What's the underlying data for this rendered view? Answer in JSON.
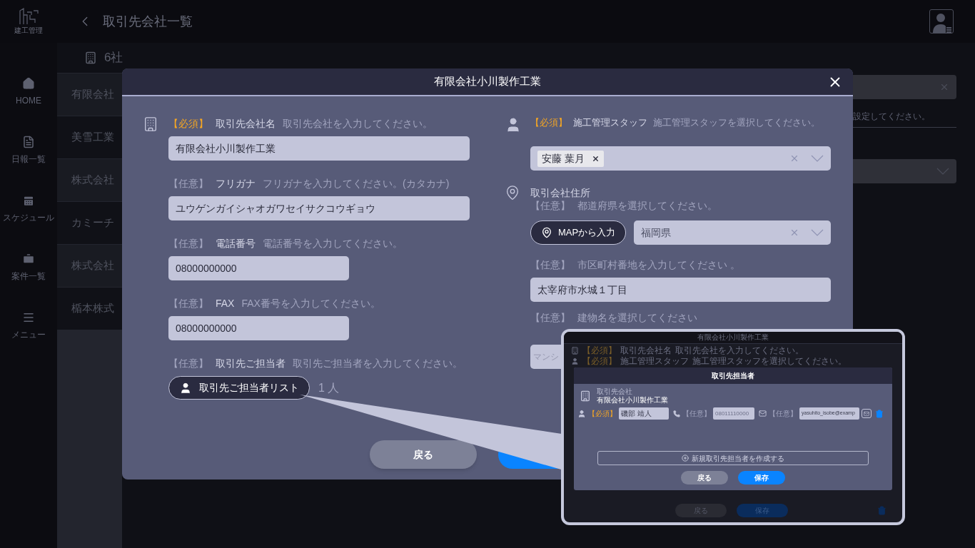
{
  "header": {
    "logo_text": "建工管理",
    "title": "取引先会社一覧"
  },
  "sidebar": {
    "items": [
      {
        "label": "HOME"
      },
      {
        "label": "日報一覧"
      },
      {
        "label": "スケジュール"
      },
      {
        "label": "案件一覧"
      },
      {
        "label": "メニュー"
      }
    ]
  },
  "list": {
    "count": "6社",
    "rows": [
      "有限会社",
      "美雪工業",
      "株式会社",
      "カミーチ",
      "株式会社",
      "楯本株式"
    ]
  },
  "side_panel": {
    "hint": "設定してください。"
  },
  "modal": {
    "title": "有限会社小川製作工業",
    "left_fields": [
      {
        "kind": "wide",
        "badge": "【必須】",
        "required": true,
        "label": "取引先会社名",
        "hint": "取引先会社を入力してください。",
        "value": "有限会社小川製作工業"
      },
      {
        "kind": "wide",
        "badge": "【任意】",
        "required": false,
        "label": "フリガナ",
        "hint": "フリガナを入力してください。(カタカナ)",
        "value": "ユウゲンガイシャオガワセイサクコウギョウ"
      },
      {
        "kind": "narrow",
        "badge": "【任意】",
        "required": false,
        "label": "電話番号",
        "hint": "電話番号を入力してください。",
        "value": "08000000000"
      },
      {
        "kind": "narrow",
        "badge": "【任意】",
        "required": false,
        "label": "FAX",
        "hint": "FAX番号を入力してください。",
        "value": "08000000000"
      },
      {
        "kind": "contacts",
        "badge": "【任意】",
        "required": false,
        "label": "取引先ご担当者",
        "hint": "取引先ご担当者を入力してください。",
        "button": "取引先ご担当者リスト",
        "count": "1 人"
      }
    ],
    "staff": {
      "badge": "【必須】",
      "required": true,
      "label": "施工管理スタッフ",
      "hint": "施工管理スタッフを選択してください。",
      "chips": [
        "安藤 葉月"
      ]
    },
    "address": {
      "title": "取引会社住所",
      "badge": "【任意】",
      "required": false,
      "hint": "都道府県を選択してください。",
      "map_button": "MAPから入力",
      "prefecture": "福岡県",
      "street_badge": "【任意】",
      "street_required": false,
      "street_hint": "市区町村番地を入力してください 。",
      "street": "太宰府市水城１丁目",
      "building_badge": "【任意】",
      "building_required": false,
      "building_hint": "建物名を選択してください",
      "building_placeholder": "マンシ"
    },
    "back_button": "戻る"
  },
  "callout": {
    "title": "有限会社小川製作工業",
    "bg_rows": [
      {
        "badge": "【必須】",
        "label": "取引先会社名",
        "hint": "取引先会社を入力してください。"
      },
      {
        "badge": "【必須】",
        "label": "施工管理スタッフ",
        "hint": "施工管理スタッフを選択してくださ"
      }
    ],
    "bg_hint_end": "い。",
    "dialog": {
      "title": "取引先担当者",
      "company_label": "取引先会社",
      "company": "有限会社小川製作工業",
      "contacts": [
        {
          "name_badge": "【必須】",
          "name": "磯部 靖人",
          "phone_badge": "【任意】",
          "phone_placeholder": "08011110000",
          "email_badge": "【任意】",
          "email": "yasuhito_isobe@examp"
        }
      ],
      "create": "新規取引先担当者を作成する",
      "back": "戻る",
      "save": "保存"
    },
    "bg_buttons": [
      "戻る",
      "保存"
    ]
  }
}
